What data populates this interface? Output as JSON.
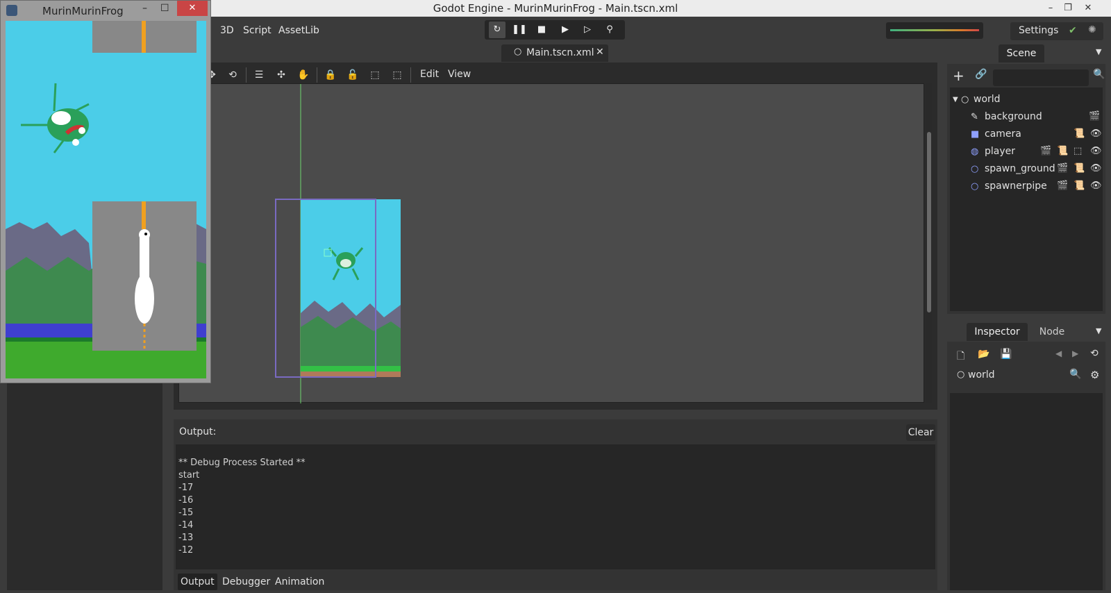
{
  "os_window": {
    "title": "Godot Engine - MurinMurinFrog - Main.tscn.xml",
    "minimize": "–",
    "restore": "❐",
    "close": "✕"
  },
  "top_menu": {
    "items": [
      "3D",
      "Script",
      "AssetLib"
    ],
    "settings_label": "Settings"
  },
  "scene_tab": {
    "label": "Main.tscn.xml",
    "close": "✕"
  },
  "viewport_menu": {
    "edit": "Edit",
    "view": "View"
  },
  "scene_dock": {
    "tab": "Scene",
    "search_placeholder": "",
    "tree": [
      {
        "name": "world",
        "icon": "node-icon"
      },
      {
        "name": "background",
        "icon": "sprite-icon"
      },
      {
        "name": "camera",
        "icon": "camera-icon"
      },
      {
        "name": "player",
        "icon": "rigidbody-icon"
      },
      {
        "name": "spawn_ground",
        "icon": "node2d-icon"
      },
      {
        "name": "spawnerpipe",
        "icon": "node2d-icon"
      }
    ]
  },
  "inspector_dock": {
    "tabs": [
      "Inspector",
      "Node"
    ],
    "selected": "world"
  },
  "output": {
    "title": "Output:",
    "clear": "Clear",
    "lines": [
      "** Debug Process Started **",
      "start",
      "-17",
      "-16",
      "-15",
      "-14",
      "-13",
      "-12"
    ],
    "bottom_tabs": [
      "Output",
      "Debugger",
      "Animation"
    ]
  },
  "game_window": {
    "title": "MurinMurinFrog",
    "minimize": "–",
    "maximize": "☐",
    "close": "✕"
  },
  "colors": {
    "sky": "#4bcde8",
    "accent": "#7a6ac2",
    "close_red": "#c94545"
  }
}
